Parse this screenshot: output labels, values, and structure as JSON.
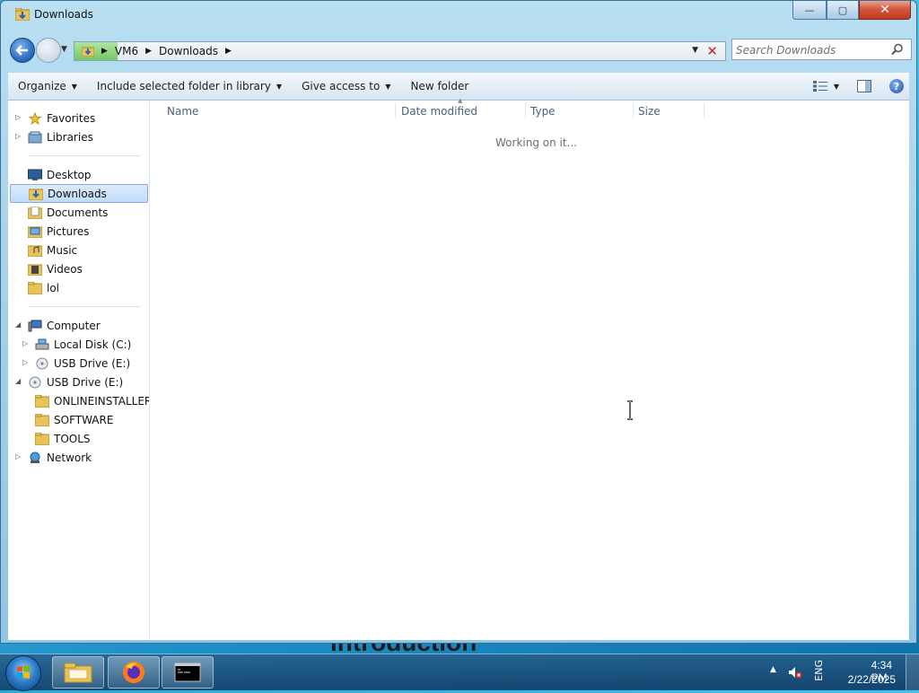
{
  "desktop": {
    "background_text": "introduction"
  },
  "window": {
    "title": "Downloads",
    "controls": {
      "minimize": "—",
      "maximize": "▢",
      "close": "✕"
    }
  },
  "address": {
    "crumbs": [
      "VM6",
      "Downloads"
    ],
    "sep": "▶",
    "dropdown": "▼",
    "stop": "✕"
  },
  "search": {
    "placeholder": "Search Downloads",
    "value": ""
  },
  "toolbar": {
    "organize": "Organize",
    "include": "Include selected folder in library",
    "give_access": "Give access to",
    "new_folder": "New folder",
    "caret": "▼",
    "help": "?"
  },
  "nav": {
    "favorites": "Favorites",
    "libraries": "Libraries",
    "desktop": "Desktop",
    "downloads": "Downloads",
    "documents": "Documents",
    "pictures": "Pictures",
    "music": "Music",
    "videos": "Videos",
    "lol": "lol",
    "computer": "Computer",
    "local_disk": "Local Disk (C:)",
    "usb_drive_child": "USB Drive (E:)",
    "usb_drive": "USB Drive (E:)",
    "onlineinstallers": "ONLINEINSTALLERS",
    "software": "SOFTWARE",
    "tools": "TOOLS",
    "network": "Network",
    "expand_closed": "▷",
    "expand_open": "◢"
  },
  "columns": {
    "name": "Name",
    "date_modified": "Date modified",
    "type": "Type",
    "size": "Size"
  },
  "status": {
    "working": "Working on it..."
  },
  "taskbar": {
    "tray_caret": "▲",
    "language": "ENG",
    "time": "4:34 PM",
    "date": "2/22/2025"
  },
  "colors": {
    "accent": "#2f6fc4",
    "selection": "#c1dcf9",
    "close_button": "#c0391f",
    "stop_icon": "#c8242b"
  },
  "icons": {
    "title": "folder-download-icon",
    "back": "back-arrow-icon",
    "forward": "forward-arrow-icon",
    "search": "search-icon",
    "view": "view-options-icon",
    "preview": "preview-pane-icon",
    "help": "help-icon"
  }
}
